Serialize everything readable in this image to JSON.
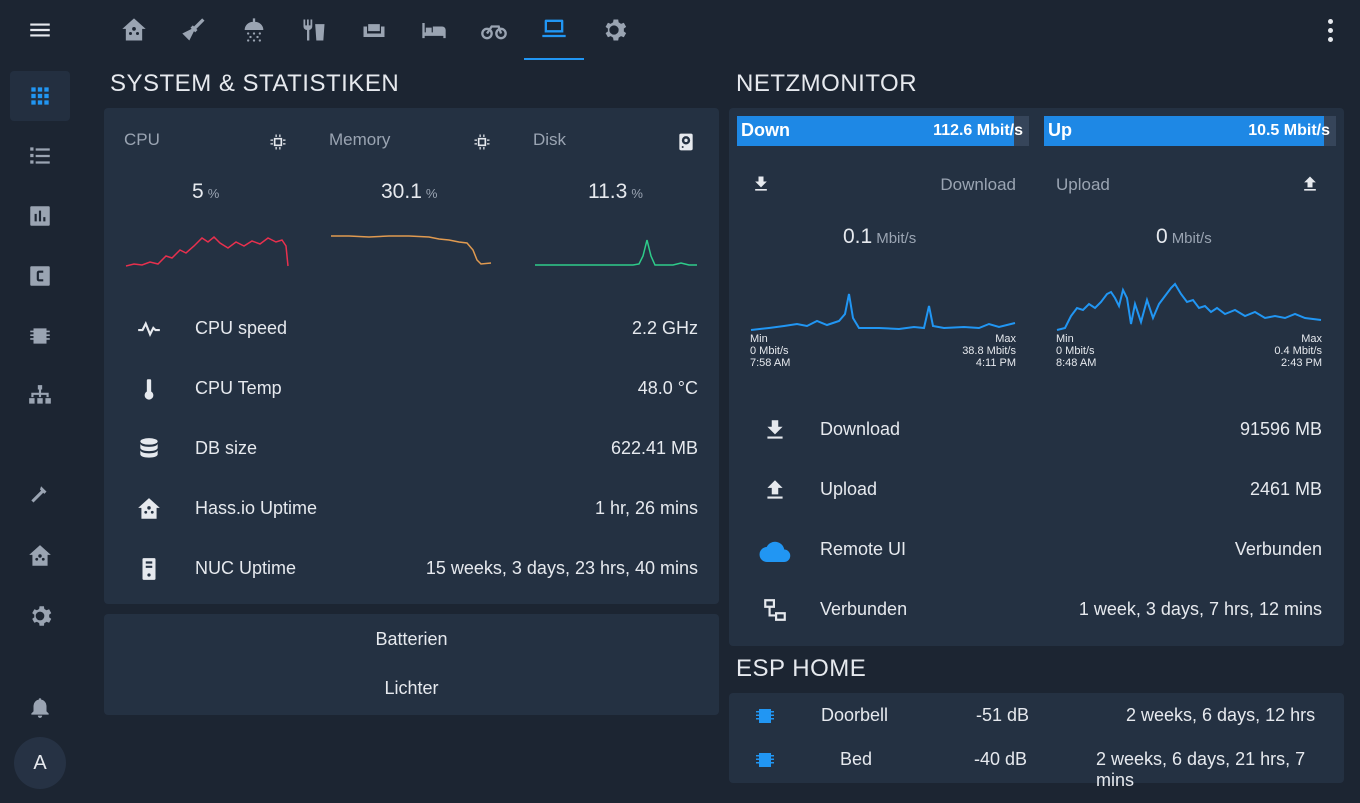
{
  "colors": {
    "accent": "#2196f3",
    "bar": "#1e88e5",
    "cpu_line": "#e8304e",
    "mem_line": "#e09a50",
    "disk_line": "#2ecc8a",
    "net_line": "#2196f3"
  },
  "tabs": [
    {
      "icon": "home-assistant-icon"
    },
    {
      "icon": "broom-icon"
    },
    {
      "icon": "shower-icon"
    },
    {
      "icon": "food-fork-drink-icon"
    },
    {
      "icon": "sofa-icon"
    },
    {
      "icon": "bed-icon"
    },
    {
      "icon": "bike-icon"
    },
    {
      "icon": "laptop-icon",
      "active": true
    },
    {
      "icon": "gear-icon"
    }
  ],
  "sidebar": {
    "avatar_letter": "A"
  },
  "system": {
    "title": "SYSTEM & STATISTIKEN",
    "gauges": [
      {
        "label": "CPU",
        "value": "5",
        "unit": "%"
      },
      {
        "label": "Memory",
        "value": "30.1",
        "unit": "%"
      },
      {
        "label": "Disk",
        "value": "11.3",
        "unit": "%"
      }
    ],
    "rows": [
      {
        "label": "CPU speed",
        "value": "2.2 GHz",
        "icon": "pulse-icon"
      },
      {
        "label": "CPU Temp",
        "value": "48.0 °C",
        "icon": "thermometer-icon"
      },
      {
        "label": "DB size",
        "value": "622.41 MB",
        "icon": "database-icon"
      },
      {
        "label": "Hass.io Uptime",
        "value": "1 hr, 26 mins",
        "icon": "home-assistant-icon"
      },
      {
        "label": "NUC Uptime",
        "value": "15 weeks, 3 days, 23 hrs, 40 mins",
        "icon": "server-icon"
      }
    ]
  },
  "buttons": {
    "batteries": "Batterien",
    "lights": "Lichter"
  },
  "net": {
    "title": "NETZMONITOR",
    "down_bar": {
      "label": "Down",
      "value": "112.6 Mbit/s",
      "fill": 0.95
    },
    "up_bar": {
      "label": "Up",
      "value": "10.5 Mbit/s",
      "fill": 0.96
    },
    "download": {
      "label": "Download",
      "value": "0.1",
      "unit": "Mbit/s",
      "min_label": "Min",
      "min_value": "0 Mbit/s",
      "min_time": "7:58 AM",
      "max_label": "Max",
      "max_value": "38.8 Mbit/s",
      "max_time": "4:11 PM"
    },
    "upload": {
      "label": "Upload",
      "value": "0",
      "unit": "Mbit/s",
      "min_label": "Min",
      "min_value": "0 Mbit/s",
      "min_time": "8:48 AM",
      "max_label": "Max",
      "max_value": "0.4 Mbit/s",
      "max_time": "2:43 PM"
    },
    "rows": [
      {
        "label": "Download",
        "value": "91596 MB",
        "icon": "download-icon"
      },
      {
        "label": "Upload",
        "value": "2461 MB",
        "icon": "upload-icon"
      },
      {
        "label": "Remote UI",
        "value": "Verbunden",
        "icon": "cloud-icon"
      },
      {
        "label": "Verbunden",
        "value": "1 week, 3 days, 7 hrs, 12 mins",
        "icon": "lan-connect-icon"
      }
    ]
  },
  "esp": {
    "title": "ESP HOME",
    "rows": [
      {
        "name": "Doorbell",
        "signal": "-51 dB",
        "uptime": "2 weeks, 6 days, 12 hrs"
      },
      {
        "name": "Bed",
        "signal": "-40 dB",
        "uptime": "2 weeks, 6 days, 21 hrs, 7 mins"
      }
    ]
  }
}
